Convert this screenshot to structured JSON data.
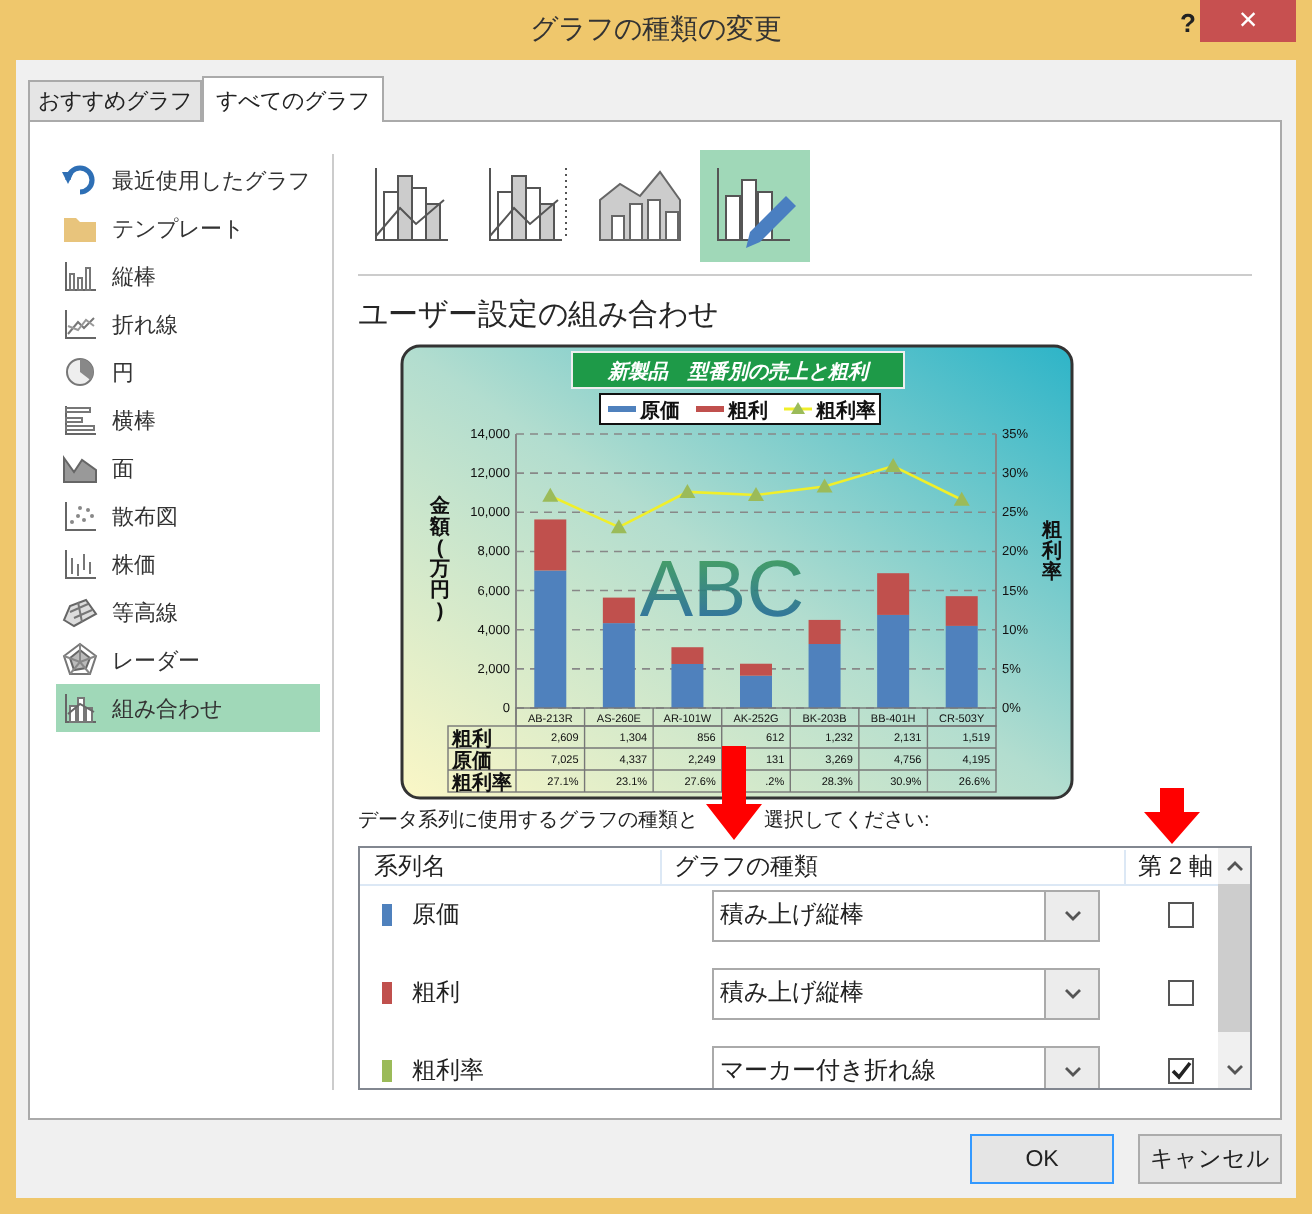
{
  "window": {
    "title": "グラフの種類の変更",
    "help": "?",
    "close": "×"
  },
  "tabs": [
    {
      "label": "おすすめグラフ",
      "selected": false
    },
    {
      "label": "すべてのグラフ",
      "selected": true
    }
  ],
  "sidebar": {
    "items": [
      {
        "kind": "recent",
        "label": "最近使用したグラフ",
        "selected": false
      },
      {
        "kind": "template",
        "label": "テンプレート",
        "selected": false
      },
      {
        "kind": "column",
        "label": "縦棒",
        "selected": false
      },
      {
        "kind": "line",
        "label": "折れ線",
        "selected": false
      },
      {
        "kind": "pie",
        "label": "円",
        "selected": false
      },
      {
        "kind": "bar",
        "label": "横棒",
        "selected": false
      },
      {
        "kind": "area",
        "label": "面",
        "selected": false
      },
      {
        "kind": "scatter",
        "label": "散布図",
        "selected": false
      },
      {
        "kind": "stock",
        "label": "株価",
        "selected": false
      },
      {
        "kind": "surface",
        "label": "等高線",
        "selected": false
      },
      {
        "kind": "radar",
        "label": "レーダー",
        "selected": false
      },
      {
        "kind": "combo",
        "label": "組み合わせ",
        "selected": true
      }
    ]
  },
  "subtypes": [
    {
      "kind": "column-line",
      "selected": false
    },
    {
      "kind": "column-line-secondary",
      "selected": false
    },
    {
      "kind": "area-column",
      "selected": false
    },
    {
      "kind": "custom",
      "selected": true
    }
  ],
  "heading": "ユーザー設定の組み合わせ",
  "preview": {
    "title": "新製品　型番別の売上と粗利",
    "wordart": "ABC",
    "y_title": "金額(万円)",
    "y2_title": "粗利率",
    "chart_data": {
      "type": "bar",
      "stacked": true,
      "categories": [
        "AB-213R",
        "AS-260E",
        "AR-101W",
        "AK-252G",
        "BK-203B",
        "BB-401H",
        "CR-503Y"
      ],
      "series": [
        {
          "name": "原価",
          "color": "#4f81bd",
          "values": [
            7025,
            4337,
            2249,
            1650,
            3269,
            4756,
            4195
          ]
        },
        {
          "name": "粗利",
          "color": "#c0504d",
          "values": [
            2609,
            1304,
            856,
            612,
            1232,
            2131,
            1519
          ]
        },
        {
          "name": "粗利率",
          "color": "#9bbb59",
          "type": "line",
          "axis": "y2",
          "marker": "triangle",
          "values": [
            27.1,
            23.1,
            27.6,
            27.2,
            28.3,
            30.9,
            26.6
          ]
        }
      ],
      "grid": true,
      "legend": "top",
      "ylim": [
        0,
        14000
      ],
      "yticks": [
        {
          "value": 0,
          "label": "0"
        },
        {
          "value": 2000,
          "label": "2,000"
        },
        {
          "value": 4000,
          "label": "4,000"
        },
        {
          "value": 6000,
          "label": "6,000"
        },
        {
          "value": 8000,
          "label": "8,000"
        },
        {
          "value": 10000,
          "label": "10,000"
        },
        {
          "value": 12000,
          "label": "12,000"
        },
        {
          "value": 14000,
          "label": "14,000"
        }
      ],
      "y2lim": [
        0,
        35
      ],
      "y2ticks": [
        {
          "value": 0,
          "label": "0%"
        },
        {
          "value": 5,
          "label": "5%"
        },
        {
          "value": 10,
          "label": "10%"
        },
        {
          "value": 15,
          "label": "15%"
        },
        {
          "value": 20,
          "label": "20%"
        },
        {
          "value": 25,
          "label": "25%"
        },
        {
          "value": 30,
          "label": "30%"
        },
        {
          "value": 35,
          "label": "35%"
        }
      ]
    },
    "data_table": [
      {
        "label": "粗利",
        "cells": [
          "2,609",
          "1,304",
          "856",
          "612",
          "1,232",
          "2,131",
          "1,519"
        ]
      },
      {
        "label": "原価",
        "cells": [
          "7,025",
          "4,337",
          "2,249",
          "131",
          "3,269",
          "4,756",
          "4,195"
        ]
      },
      {
        "label": "粗利率",
        "cells": [
          "27.1%",
          "23.1%",
          "27.6%",
          ".2%",
          "28.3%",
          "30.9%",
          "26.6%"
        ]
      }
    ]
  },
  "instruction": [
    "データ系列に使用するグラフの種類と",
    "選択してください:"
  ],
  "series_table": {
    "columns": [
      "系列名",
      "グラフの種類",
      "第 2 軸"
    ],
    "rows": [
      {
        "name": "原価",
        "color": "#4f81bd",
        "chart_type": "積み上げ縦棒",
        "secondary_axis": false
      },
      {
        "name": "粗利",
        "color": "#c0504d",
        "chart_type": "積み上げ縦棒",
        "secondary_axis": false
      },
      {
        "name": "粗利率",
        "color": "#9bbb59",
        "chart_type": "マーカー付き折れ線",
        "secondary_axis": true
      }
    ]
  },
  "buttons": [
    {
      "label": "OK",
      "default": true
    },
    {
      "label": "キャンセル",
      "default": false
    }
  ]
}
